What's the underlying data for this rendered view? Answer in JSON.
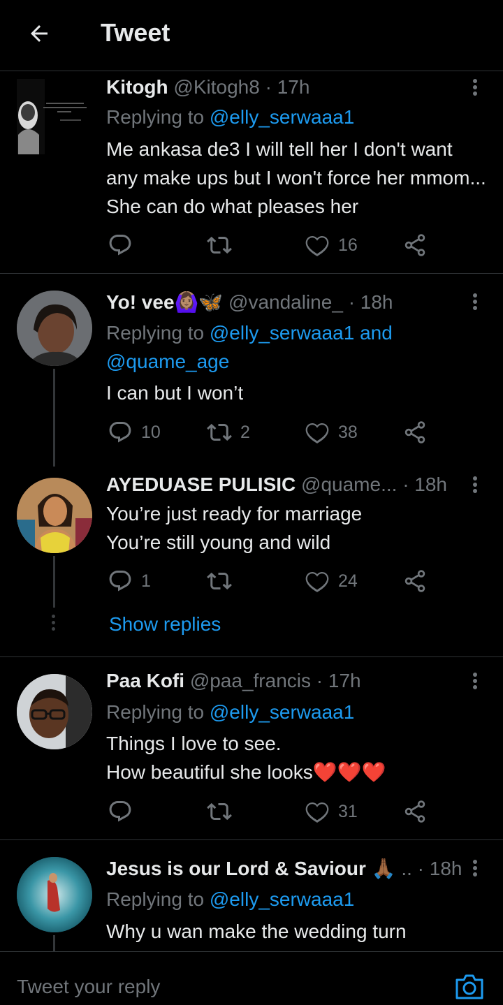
{
  "header": {
    "title": "Tweet"
  },
  "tweets": [
    {
      "name": "Kitogh",
      "handle": "@Kitogh8",
      "time": "· 17h",
      "replying_prefix": "Replying to",
      "replying_to": "@elly_serwaaa1",
      "text": "Me ankasa de3 I will tell her I don't want any make ups but I won't force her mmom... She can do what pleases her",
      "replies": "",
      "retweets": "",
      "likes": "16"
    },
    {
      "name": "Yo! vee🙆🏽‍♀️🦋",
      "handle": "@vandaline_",
      "time": "· 18h",
      "replying_prefix": "Replying to",
      "replying_to": "@elly_serwaaa1",
      "replying_and": "and",
      "replying_to_2": "@quame_age",
      "text": "I can but I won’t",
      "replies": "10",
      "retweets": "2",
      "likes": "38"
    },
    {
      "name": "AYEDUASE PULISIC",
      "handle": "@quame...",
      "time": "· 18h",
      "text_line1": "You’re just ready for marriage",
      "text_line2": "You’re still young and wild",
      "replies": "1",
      "retweets": "",
      "likes": "24",
      "show_replies": "Show replies"
    },
    {
      "name": "Paa Kofi",
      "handle": "@paa_francis",
      "time": "· 17h",
      "replying_prefix": "Replying to",
      "replying_to": "@elly_serwaaa1",
      "text_line1": "Things I love to see.",
      "text_line2": "How beautiful she looks❤️❤️❤️",
      "replies": "",
      "retweets": "",
      "likes": "31"
    },
    {
      "name": "Jesus is our Lord & Saviour 🙏🏾",
      "handle": "..",
      "time": "· 18h",
      "replying_prefix": "Replying to",
      "replying_to": "@elly_serwaaa1",
      "text": "Why u wan make the wedding turn"
    }
  ],
  "composer": {
    "placeholder": "Tweet your reply"
  },
  "colors": {
    "accent": "#1d9bf0",
    "background": "#000000",
    "muted": "#71767b",
    "text": "#e7e9ea",
    "divider": "#2f3336"
  },
  "icons": [
    "back-arrow-icon",
    "more-vertical-icon",
    "reply-icon",
    "retweet-icon",
    "like-icon",
    "share-icon",
    "camera-icon"
  ]
}
